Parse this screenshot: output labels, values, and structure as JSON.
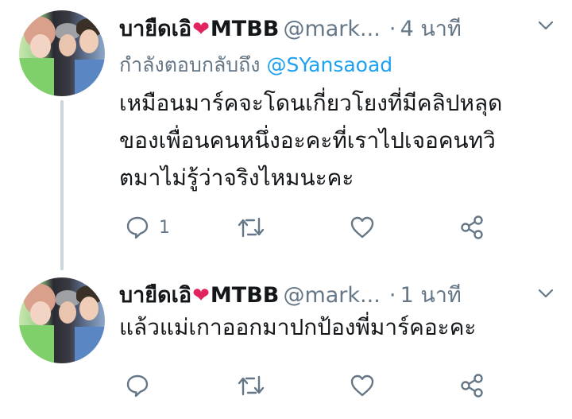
{
  "tweets": [
    {
      "name": "บายืดเอิ",
      "name_suffix": "MTBB",
      "handle": "@mark...",
      "dot": "·",
      "time": "4 นาที",
      "reply_prefix": "กำลังตอบกลับถึง",
      "reply_to": "@SYansaoad",
      "text_lines": [
        "เหมือนมาร์คจะโดนเกี่ยวโยงที่มีคลิปหลุด",
        "ของเพื่อนคนหนึ่งอะคะที่เราไปเจอคนทวิ",
        "ตมาไม่รู้ว่าจริงไหมนะคะ"
      ],
      "reply_count": "1"
    },
    {
      "name": "บายืดเอิ",
      "name_suffix": "MTBB",
      "handle": "@mark...",
      "dot": "·",
      "time": "1 นาที",
      "text_lines": [
        "แล้วแม่เกาออกมาปกป้องพี่มาร์คอะคะ"
      ]
    }
  ],
  "icons": [
    "reply-icon",
    "retweet-icon",
    "like-icon",
    "share-icon",
    "chevron-down-icon"
  ],
  "colors": {
    "text": "#14171a",
    "muted": "#657786",
    "link": "#1da1f2",
    "heart": "#e0245e",
    "thread_line": "#ccd6dd"
  }
}
